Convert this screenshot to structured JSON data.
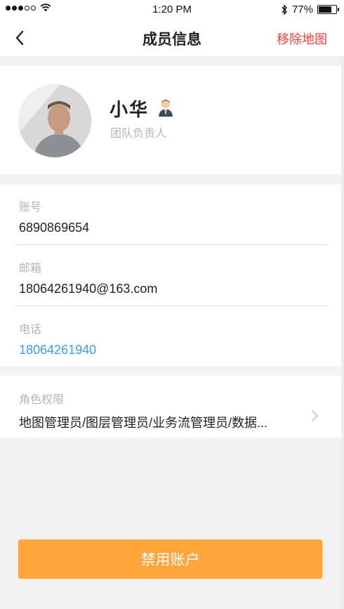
{
  "status_bar": {
    "time": "1:20 PM",
    "battery": "77%",
    "battery_level": 0.77
  },
  "nav": {
    "title": "成员信息",
    "action_label": "移除地图",
    "back_icon": "back-chevron-icon"
  },
  "profile": {
    "name": "小华",
    "role": "团队负责人",
    "badge_icon": "leader-person-icon"
  },
  "fields": {
    "account": {
      "label": "账号",
      "value": "6890869654"
    },
    "email": {
      "label": "邮箱",
      "value": "18064261940@163.com"
    },
    "phone": {
      "label": "电话",
      "value": "18064261940"
    }
  },
  "permissions": {
    "label": "角色权限",
    "value": "地图管理员/图层管理员/业务流管理员/数据..."
  },
  "footer": {
    "button_label": "禁用账户"
  },
  "colors": {
    "accent": "#ffa53c",
    "danger": "#f5423a",
    "link": "#3aa0e8",
    "muted": "#b5b5b5"
  }
}
